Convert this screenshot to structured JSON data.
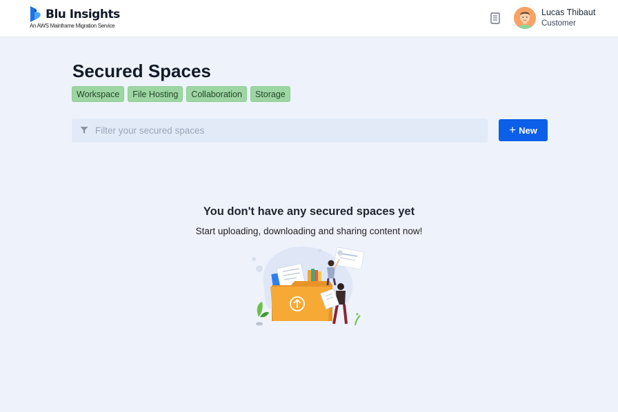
{
  "brand": {
    "title": "Blu Insights",
    "subtitle": "An AWS Mainframe Migration Service",
    "accent_color": "#0b5fe8"
  },
  "header": {
    "docs_icon": "book-icon",
    "user": {
      "name": "Lucas Thibaut",
      "role": "Customer",
      "avatar_color": "#f8a266"
    }
  },
  "page": {
    "title": "Secured Spaces",
    "tags": [
      "Workspace",
      "File Hosting",
      "Collaboration",
      "Storage"
    ],
    "tag_color": "#9ed6a3"
  },
  "filter": {
    "icon": "filter-icon",
    "value": "",
    "placeholder": "Filter your secured spaces"
  },
  "actions": {
    "new_label": "New",
    "new_icon": "plus-icon"
  },
  "empty_state": {
    "title": "You don't have any secured spaces yet",
    "subtitle": "Start uploading, downloading and sharing content now!",
    "illustration": "folder-upload-illustration"
  }
}
